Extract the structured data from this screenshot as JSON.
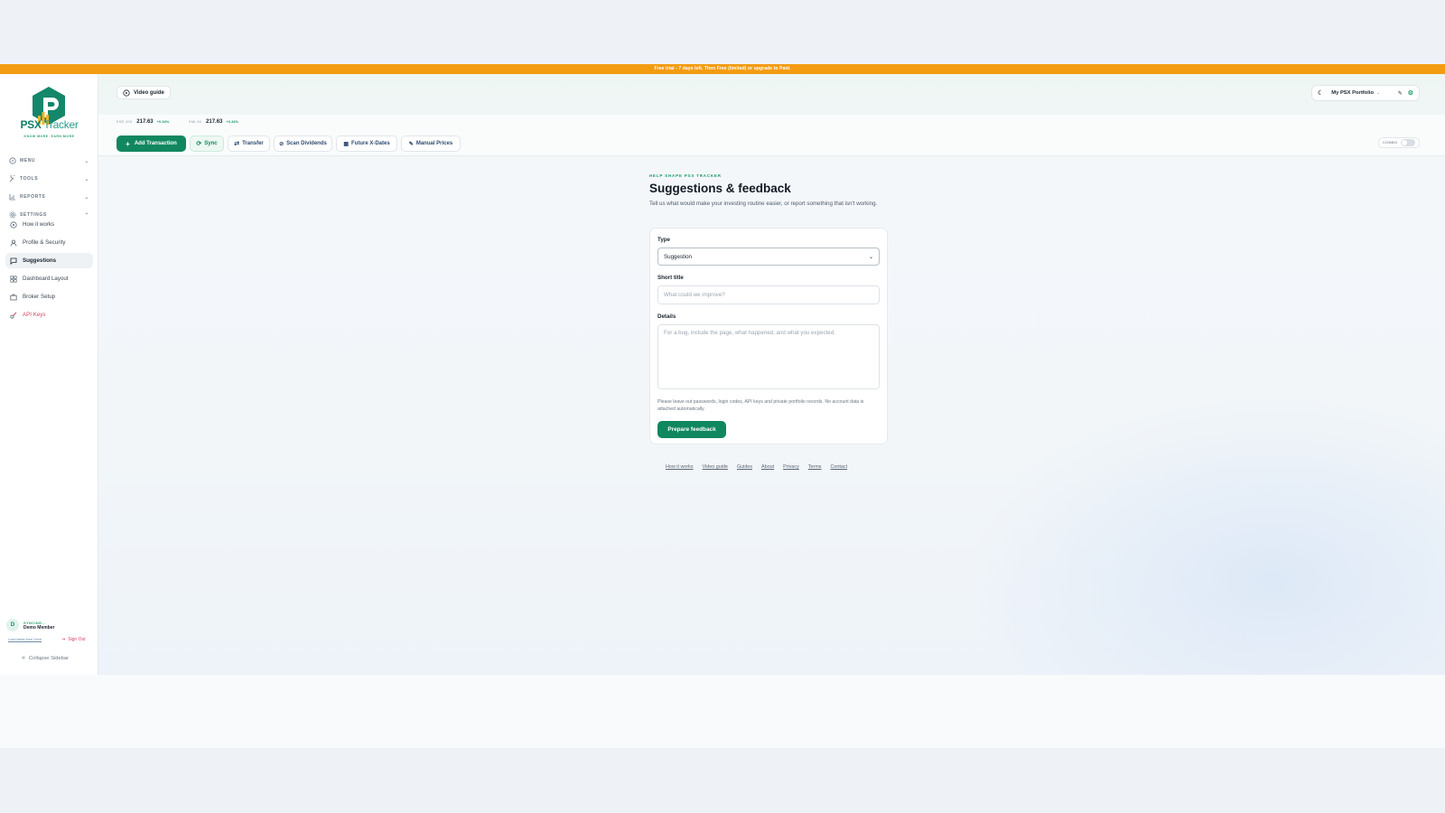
{
  "banner": {
    "text": "Free trial - 7 days left. Then Free (limited) or upgrade to Paid."
  },
  "sidebar": {
    "brand": {
      "name": "PSX",
      "suffix": " Tracker",
      "tagline": "KNOW MORE. EARN MORE"
    },
    "groups": [
      {
        "label": "MENU",
        "icon": "grid-icon"
      },
      {
        "label": "TOOLS",
        "icon": "wrench-icon"
      },
      {
        "label": "REPORTS",
        "icon": "bar-chart-icon"
      },
      {
        "label": "SETTINGS",
        "icon": "gear-icon"
      }
    ],
    "items": [
      {
        "label": "How it works",
        "icon": "help-icon"
      },
      {
        "label": "Profile & Security",
        "icon": "user-icon"
      },
      {
        "label": "Suggestions",
        "icon": "message-icon",
        "active": true
      },
      {
        "label": "Dashboard Layout",
        "icon": "layout-icon"
      },
      {
        "label": "Broker Setup",
        "icon": "briefcase-icon"
      },
      {
        "label": "API Keys",
        "icon": "key-icon"
      }
    ],
    "user": {
      "initial": "D",
      "status": "SYNCING...",
      "name": "Demo Member"
    },
    "load_link": "Load latest from Drive",
    "sign_out": "Sign Out",
    "collapse": "Collapse Sidebar"
  },
  "header": {
    "video_guide": "Video guide",
    "portfolio": "My PSX Portfolio",
    "tickers": [
      {
        "name": "KSE-100",
        "value": "217.63",
        "change": "+0.34%"
      },
      {
        "name": "KMI-30",
        "value": "217.63",
        "change": "+0.34%"
      }
    ]
  },
  "toolbar": {
    "add": "Add Transaction",
    "sync": "Sync",
    "transfer": "Transfer",
    "scan": "Scan Dividends",
    "future": "Future X-Dates",
    "manual": "Manual Prices",
    "combo": "COMBO"
  },
  "feedback": {
    "eyebrow": "HELP SHAPE PSX TRACKER",
    "title": "Suggestions & feedback",
    "intro": "Tell us what would make your investing routine easier, or report something that isn't working.",
    "type_label": "Type",
    "type_value": "Suggestion",
    "title_label": "Short title",
    "title_placeholder": "What could we improve?",
    "details_label": "Details",
    "details_placeholder": "For a bug, include the page, what happened, and what you expected.",
    "note": "Please leave out passwords, login codes, API keys and private portfolio records. No account data is attached automatically.",
    "submit": "Prepare feedback"
  },
  "footer": {
    "links": [
      "How it works",
      "Video guide",
      "Guides",
      "About",
      "Privacy",
      "Terms",
      "Contact"
    ]
  },
  "colors": {
    "accent": "#11875f",
    "banner": "#f39c12",
    "danger": "#d64565"
  }
}
